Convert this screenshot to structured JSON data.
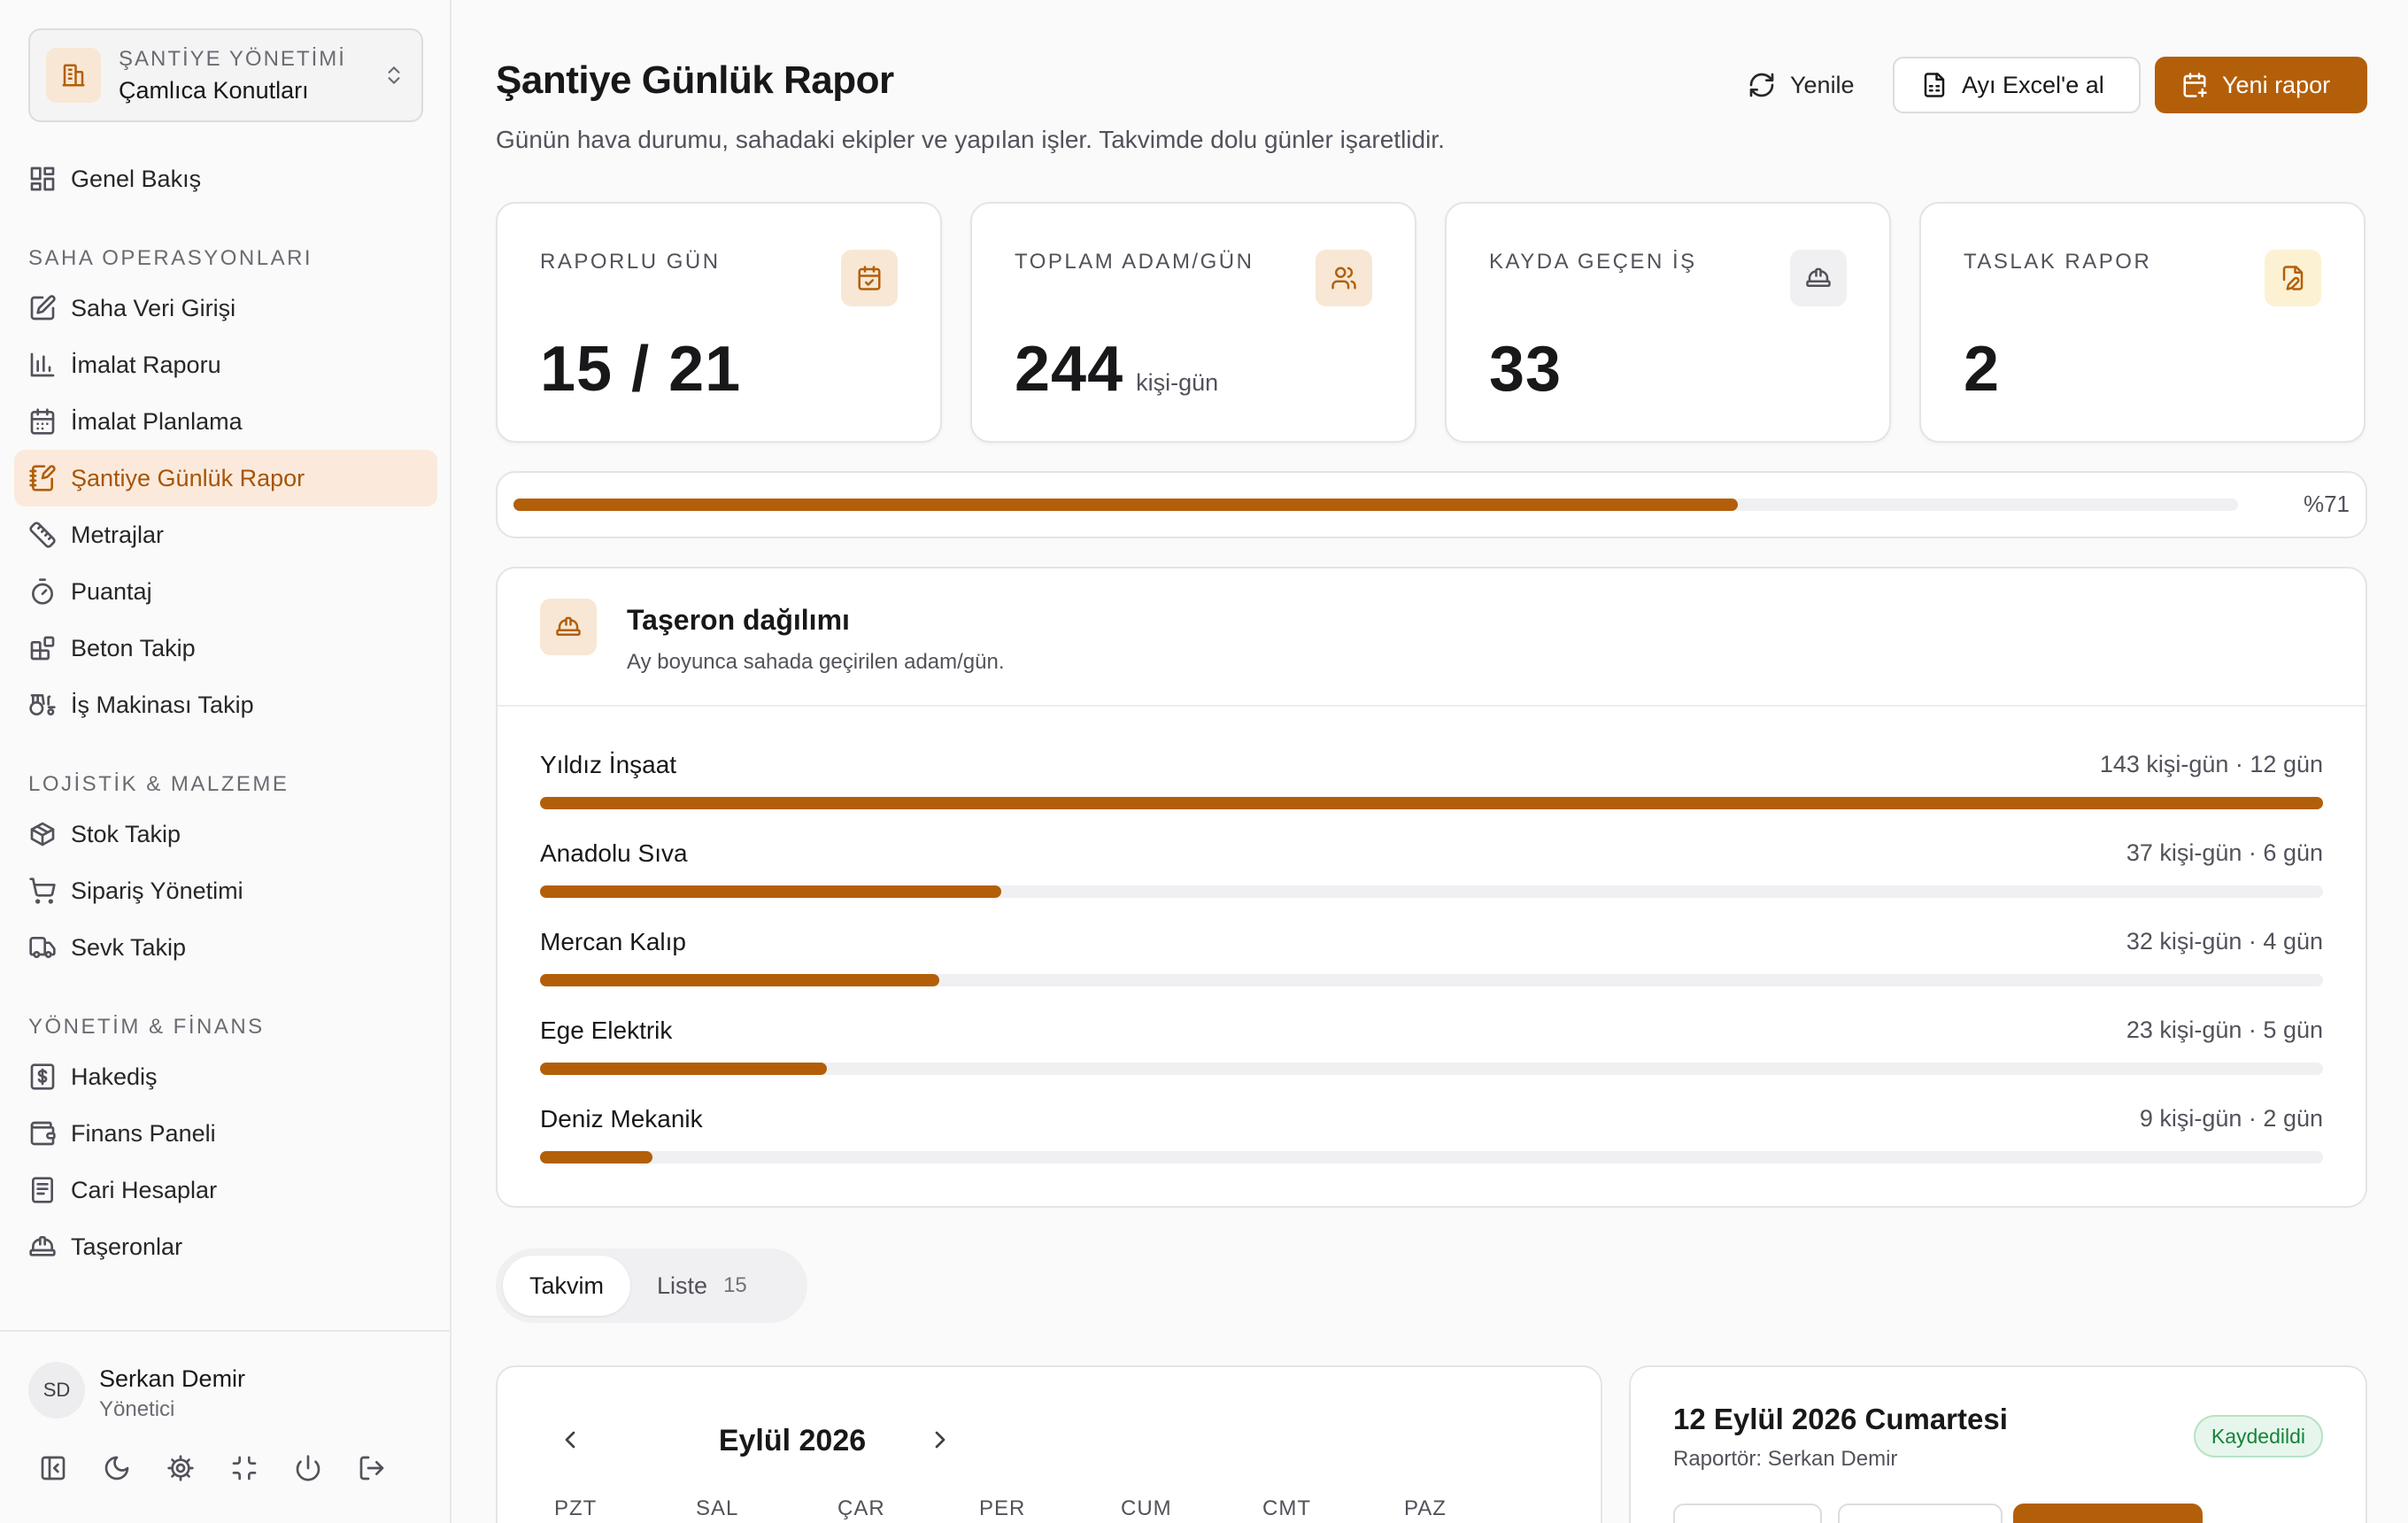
{
  "project": {
    "kicker": "ŞANTİYE YÖNETİMİ",
    "name": "Çamlıca Konutları"
  },
  "nav": {
    "overview": "Genel Bakış",
    "sections": {
      "saha": "SAHA OPERASYONLARI",
      "lojistik": "LOJİSTİK & MALZEME",
      "yonetim": "YÖNETİM & FİNANS"
    },
    "saha_items": [
      {
        "label": "Saha Veri Girişi",
        "icon": "edit-icon"
      },
      {
        "label": "İmalat Raporu",
        "icon": "bar-chart-icon"
      },
      {
        "label": "İmalat Planlama",
        "icon": "calendar-icon"
      },
      {
        "label": "Şantiye Günlük Rapor",
        "icon": "notebook-pen-icon"
      },
      {
        "label": "Metrajlar",
        "icon": "ruler-icon"
      },
      {
        "label": "Puantaj",
        "icon": "timer-icon"
      },
      {
        "label": "Beton Takip",
        "icon": "blocks-icon"
      },
      {
        "label": "İş Makinası Takip",
        "icon": "tractor-icon"
      }
    ],
    "lojistik_items": [
      {
        "label": "Stok Takip",
        "icon": "package-icon"
      },
      {
        "label": "Sipariş Yönetimi",
        "icon": "cart-icon"
      },
      {
        "label": "Sevk Takip",
        "icon": "truck-icon"
      }
    ],
    "yonetim_items": [
      {
        "label": "Hakediş",
        "icon": "receipt-icon"
      },
      {
        "label": "Finans Paneli",
        "icon": "wallet-icon"
      },
      {
        "label": "Cari Hesaplar",
        "icon": "ledger-icon"
      },
      {
        "label": "Taşeronlar",
        "icon": "hard-hat-icon"
      }
    ]
  },
  "user": {
    "initials": "SD",
    "name": "Serkan Demir",
    "role": "Yönetici"
  },
  "header": {
    "title": "Şantiye Günlük Rapor",
    "subtitle": "Günün hava durumu, sahadaki ekipler ve yapılan işler. Takvimde dolu günler işaretlidir.",
    "refresh_label": "Yenile",
    "excel_label": "Ayı Excel'e al",
    "new_report_label": "Yeni rapor"
  },
  "stats": [
    {
      "label": "RAPORLU GÜN",
      "value": "15 / 21",
      "unit": "",
      "icon": "calendar-check-icon"
    },
    {
      "label": "TOPLAM ADAM/GÜN",
      "value": "244",
      "unit": "kişi-gün",
      "icon": "users-icon"
    },
    {
      "label": "KAYDA GEÇEN İŞ",
      "value": "33",
      "unit": "",
      "icon": "hard-hat-icon"
    },
    {
      "label": "TASLAK RAPOR",
      "value": "2",
      "unit": "",
      "icon": "file-pen-icon"
    }
  ],
  "progress": {
    "percent": 71,
    "label": "%71"
  },
  "subcontractors": {
    "title": "Taşeron dağılımı",
    "description": "Ay boyunca sahada geçirilen adam/gün.",
    "items": [
      {
        "name": "Yıldız İnşaat",
        "meta": "143 kişi-gün · 12 gün",
        "value": 143
      },
      {
        "name": "Anadolu Sıva",
        "meta": "37 kişi-gün · 6 gün",
        "value": 37
      },
      {
        "name": "Mercan Kalıp",
        "meta": "32 kişi-gün · 4 gün",
        "value": 32
      },
      {
        "name": "Ege Elektrik",
        "meta": "23 kişi-gün · 5 gün",
        "value": 23
      },
      {
        "name": "Deniz Mekanik",
        "meta": "9 kişi-gün · 2 gün",
        "value": 9
      }
    ],
    "max": 143
  },
  "tabs": {
    "calendar": "Takvim",
    "list": "Liste",
    "list_count": "15"
  },
  "calendar": {
    "month": "Eylül 2026",
    "weekdays": [
      "PZT",
      "SAL",
      "ÇAR",
      "PER",
      "CUM",
      "CMT",
      "PAZ"
    ]
  },
  "day_detail": {
    "title": "12 Eylül 2026 Cumartesi",
    "reporter": "Raportör: Serkan Demir",
    "status": "Kaydedildi"
  },
  "colors": {
    "accent": "#b35f0a",
    "accent_soft": "#f7e7d4",
    "success": "#16833a"
  }
}
